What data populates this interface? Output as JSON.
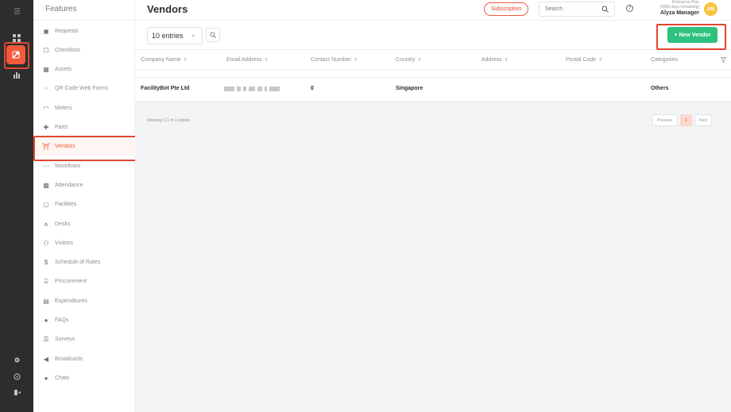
{
  "rail": {
    "icons": [
      "collapse-icon",
      "dashboard-icon",
      "features-icon",
      "reports-icon",
      "settings-icon",
      "help-icon",
      "logout-icon"
    ]
  },
  "features": {
    "title": "Features",
    "items": [
      {
        "label": "Requests",
        "icon": "requests-icon",
        "glyph": "▣"
      },
      {
        "label": "Checklists",
        "icon": "checklist-icon",
        "glyph": "☐"
      },
      {
        "label": "Assets",
        "icon": "assets-icon",
        "glyph": "▦"
      },
      {
        "label": "QR Code Web Forms",
        "icon": "qr-code-icon",
        "glyph": "⁘"
      },
      {
        "label": "Meters",
        "icon": "meter-icon",
        "glyph": "◠"
      },
      {
        "label": "Parts",
        "icon": "parts-icon",
        "glyph": "✚"
      },
      {
        "label": "Vendors",
        "icon": "vendors-icon",
        "glyph": "⛩"
      },
      {
        "label": "Workflows",
        "icon": "workflow-icon",
        "glyph": "⋯"
      },
      {
        "label": "Attendance",
        "icon": "attendance-icon",
        "glyph": "▩"
      },
      {
        "label": "Facilities",
        "icon": "facilities-icon",
        "glyph": "▢"
      },
      {
        "label": "Desks",
        "icon": "desks-icon",
        "glyph": "∧"
      },
      {
        "label": "Visitors",
        "icon": "visitors-icon",
        "glyph": "⚇"
      },
      {
        "label": "Schedule of Rates",
        "icon": "dollar-icon",
        "glyph": "$"
      },
      {
        "label": "Procurement",
        "icon": "procurement-icon",
        "glyph": "⌸"
      },
      {
        "label": "Expenditures",
        "icon": "expenditures-icon",
        "glyph": "▤"
      },
      {
        "label": "FAQs",
        "icon": "faq-icon",
        "glyph": "●"
      },
      {
        "label": "Surveys",
        "icon": "surveys-icon",
        "glyph": "☰"
      },
      {
        "label": "Broadcasts",
        "icon": "broadcast-icon",
        "glyph": "◀"
      },
      {
        "label": "Chats",
        "icon": "chat-icon",
        "glyph": "●"
      }
    ],
    "active": "Vendors"
  },
  "header": {
    "title": "Vendors",
    "subscription_label": "Subscription",
    "search_placeholder": "Search",
    "plan_name": "Enterprise Plan",
    "plan_days": "(9999 days remaining)",
    "user_name": "Alyza Manager",
    "avatar_initials": "AM"
  },
  "toolbar": {
    "entries_value": "10 entries",
    "new_vendor_label": "+ New Vendor"
  },
  "table": {
    "columns": [
      {
        "label": "Company Name",
        "sortable": true
      },
      {
        "label": "Email Address",
        "sortable": true
      },
      {
        "label": "Contact Number",
        "sortable": true
      },
      {
        "label": "Country",
        "sortable": true
      },
      {
        "label": "Address",
        "sortable": true
      },
      {
        "label": "Postal Code",
        "sortable": true
      },
      {
        "label": "Categories",
        "sortable": false
      }
    ],
    "rows": [
      {
        "company": "FacilityBot Pte Ltd",
        "email": "",
        "contact": "0",
        "country": "Singapore",
        "address": "",
        "postal": "",
        "categories": "Others"
      }
    ],
    "info": "Showing 1-1 of 1 entries"
  },
  "pagination": {
    "previous": "Previous",
    "current": "1",
    "next": "Next"
  },
  "colors": {
    "accent": "#f15a3a",
    "primary_green": "#2ec27e",
    "rail_bg": "#2b2d2e"
  }
}
